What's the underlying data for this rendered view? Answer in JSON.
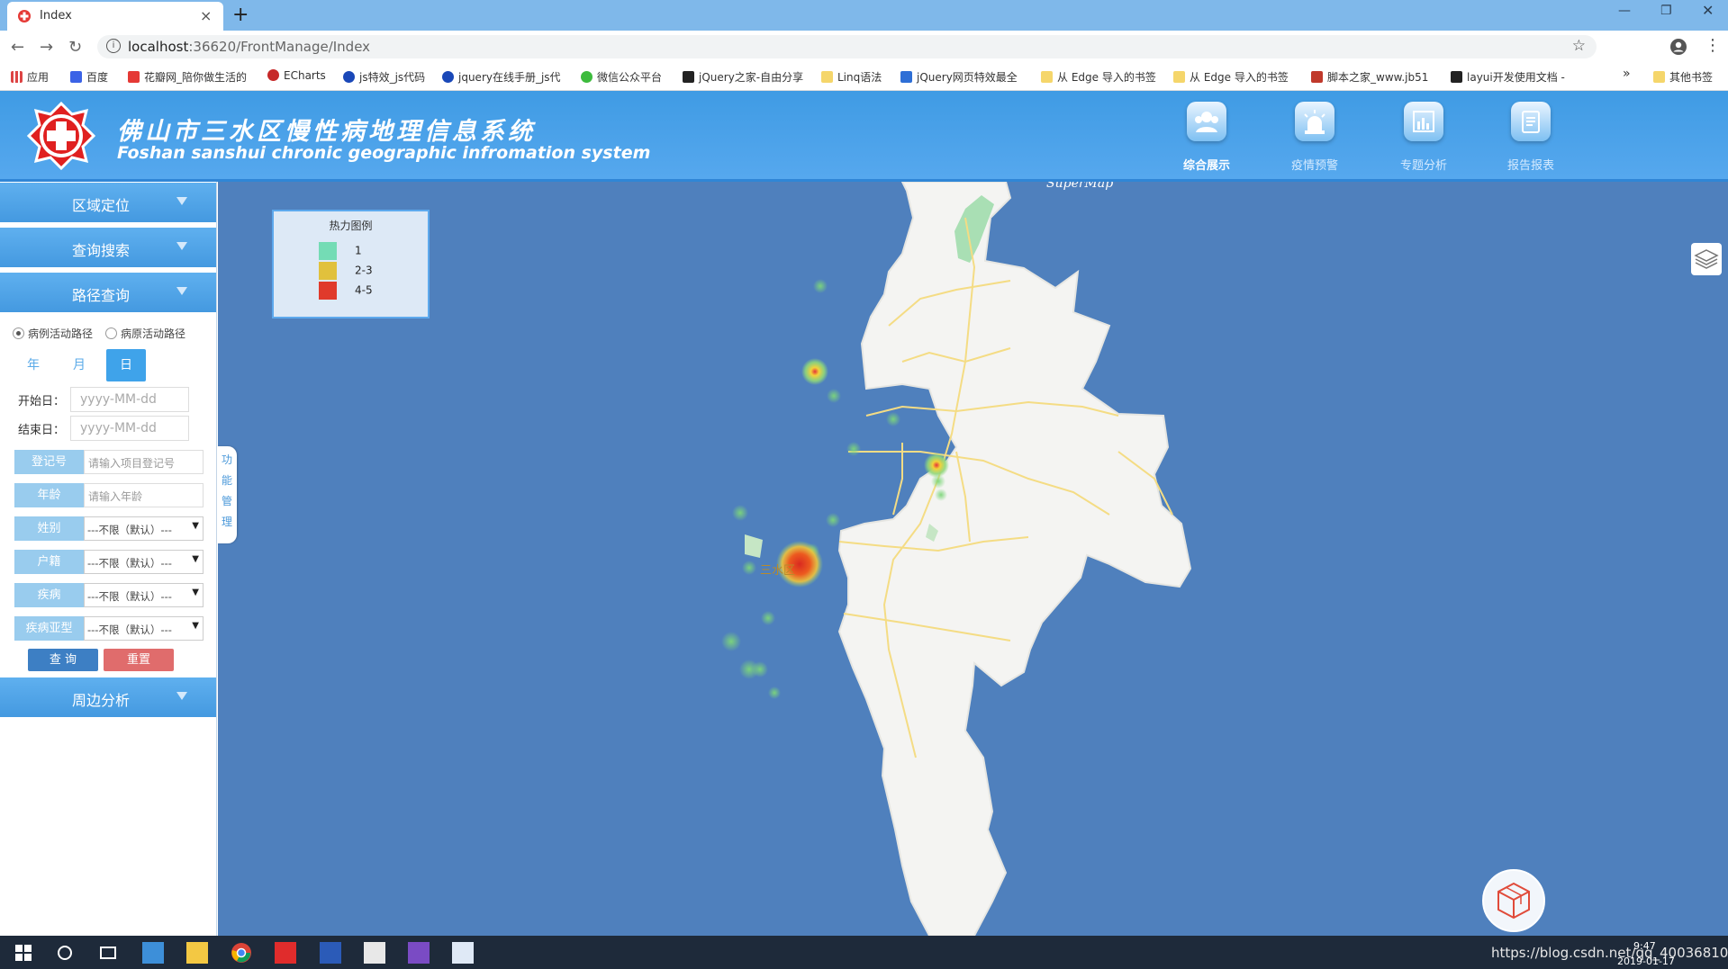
{
  "browser": {
    "tab_title": "Index",
    "url_host": "localhost",
    "url_rest": ":36620/FrontManage/Index",
    "bookmarks": [
      "应用",
      "百度",
      "花瓣网_陪你做生活的",
      "ECharts",
      "js特效_js代码",
      "jquery在线手册_js代",
      "微信公众平台",
      "jQuery之家-自由分享",
      "Linq语法",
      "jQuery网页特效最全",
      "从 Edge 导入的书签",
      "从 Edge 导入的书签",
      "脚本之家_www.jb51",
      "layui开发使用文档 -",
      "»",
      "其他书签"
    ]
  },
  "header": {
    "title_cn": "佛山市三水区慢性病地理信息系统",
    "title_en": "Foshan sanshui chronic geographic infromation system",
    "nav": [
      {
        "label": "综合展示",
        "icon": "people-icon",
        "active": true
      },
      {
        "label": "疫情预警",
        "icon": "alarm-icon",
        "active": false
      },
      {
        "label": "专题分析",
        "icon": "chart-icon",
        "active": false
      },
      {
        "label": "报告报表",
        "icon": "report-icon",
        "active": false
      }
    ]
  },
  "sidebar": {
    "accordions": [
      "区域定位",
      "查询搜索",
      "路径查询",
      "周边分析"
    ],
    "radios": [
      "病例活动路径",
      "病原活动路径"
    ],
    "segments": [
      "年",
      "月",
      "日"
    ],
    "start_label": "开始日：",
    "end_label": "结束日：",
    "date_placeholder": "yyyy-MM-dd",
    "fields": [
      {
        "label": "登记号",
        "placeholder": "请输入项目登记号",
        "type": "input"
      },
      {
        "label": "年龄",
        "placeholder": "请输入年龄",
        "type": "input"
      },
      {
        "label": "姓别",
        "value": "---不限（默认）---",
        "type": "select"
      },
      {
        "label": "户籍",
        "value": "---不限（默认）---",
        "type": "select"
      },
      {
        "label": "疾病",
        "value": "---不限（默认）---",
        "type": "select"
      },
      {
        "label": "疾病亚型",
        "value": "---不限（默认）---",
        "type": "select"
      }
    ],
    "query_btn": "查 询",
    "reset_btn": "重置",
    "side_tab": [
      "功",
      "能",
      "管",
      "理"
    ]
  },
  "map": {
    "legend_title": "热力图例",
    "legend": [
      {
        "label": "1",
        "color": "#74dcb5"
      },
      {
        "label": "2-3",
        "color": "#e1c13c"
      },
      {
        "label": "4-5",
        "color": "#e03a2b"
      }
    ],
    "brand": "SuperMap",
    "place_label": "三水区"
  },
  "taskbar": {
    "time": "9:47",
    "date": "2019-01-17",
    "watermark": "https://blog.csdn.net/qq_40036810"
  }
}
